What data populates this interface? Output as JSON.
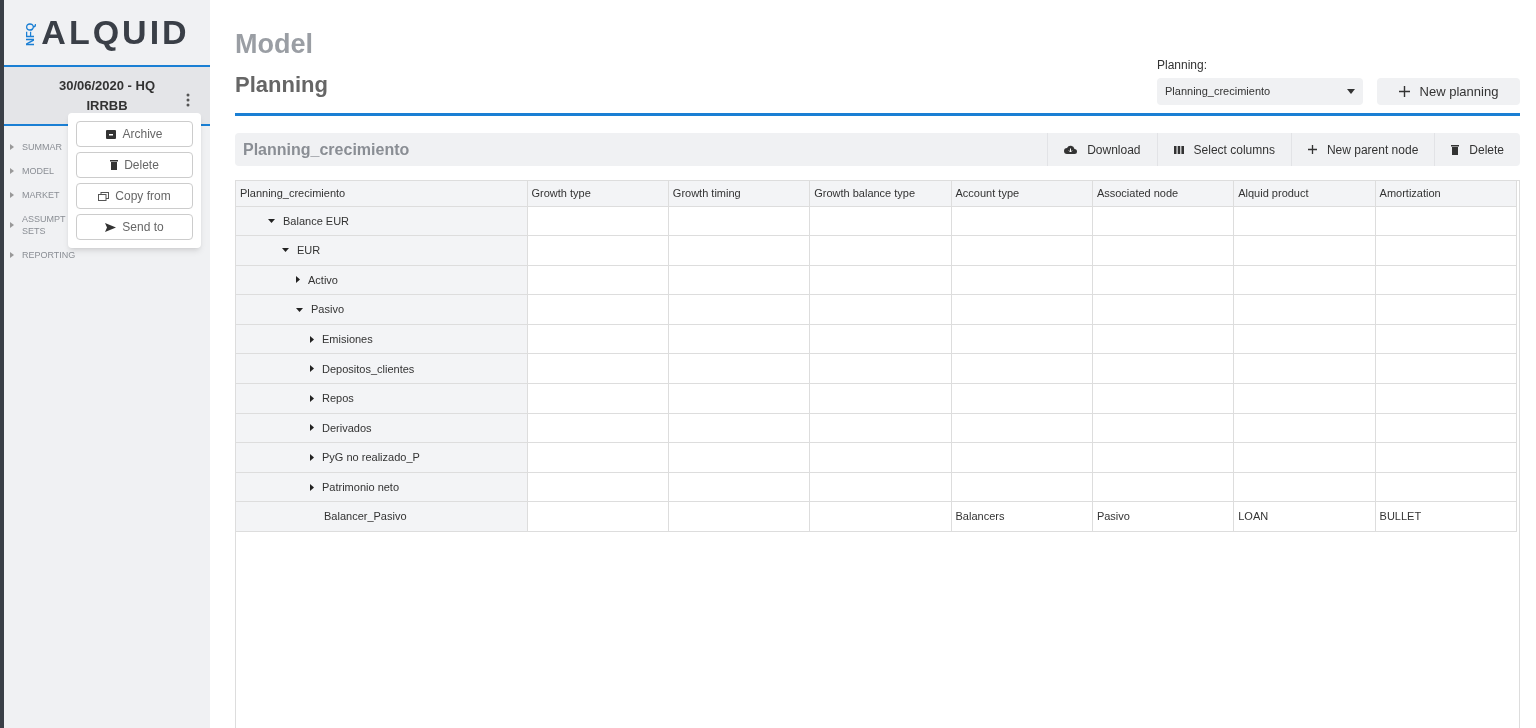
{
  "logo": {
    "prefix": "NFQ",
    "name": "ALQUID"
  },
  "context": {
    "title": "30/06/2020 - HQ",
    "subtitle": "IRRBB"
  },
  "context_menu": [
    "Archive",
    "Delete",
    "Copy from",
    "Send to"
  ],
  "sidebar": {
    "items": [
      {
        "label": "SUMMAR",
        "expanded": false
      },
      {
        "label": "MODEL",
        "expanded": false
      },
      {
        "label": "MARKET",
        "expanded": false
      },
      {
        "label": "ASSUMPT SETS",
        "expanded": false
      },
      {
        "label": "REPORTING",
        "expanded": false
      }
    ]
  },
  "page_title": "Model",
  "section_title": "Planning",
  "planning_select": {
    "label": "Planning:",
    "value": "Planning_crecimiento"
  },
  "new_planning_button": "New planning",
  "panel": {
    "title": "Planning_crecimiento",
    "actions": [
      "Download",
      "Select columns",
      "New parent node",
      "Delete"
    ]
  },
  "table": {
    "columns": [
      "Planning_crecimiento",
      "Growth type",
      "Growth timing",
      "Growth balance type",
      "Account type",
      "Associated node",
      "Alquid product",
      "Amortization"
    ],
    "rows": [
      {
        "label": "Balance EUR",
        "expanded": true,
        "children": [
          {
            "label": "EUR",
            "expanded": true,
            "children": [
              {
                "label": "Activo",
                "expanded": false
              },
              {
                "label": "Pasivo",
                "expanded": true,
                "children": [
                  {
                    "label": "Emisiones",
                    "expanded": false
                  },
                  {
                    "label": "Depositos_clientes",
                    "expanded": false
                  },
                  {
                    "label": "Repos",
                    "expanded": false
                  },
                  {
                    "label": "Derivados",
                    "expanded": false
                  },
                  {
                    "label": "PyG no realizado_P",
                    "expanded": false
                  },
                  {
                    "label": "Patrimonio neto",
                    "expanded": false
                  },
                  {
                    "label": "Balancer_Pasivo",
                    "cells": [
                      "",
                      "",
                      "",
                      "Balancers",
                      "Pasivo",
                      "LOAN",
                      "BULLET"
                    ]
                  }
                ]
              }
            ]
          }
        ]
      }
    ]
  }
}
